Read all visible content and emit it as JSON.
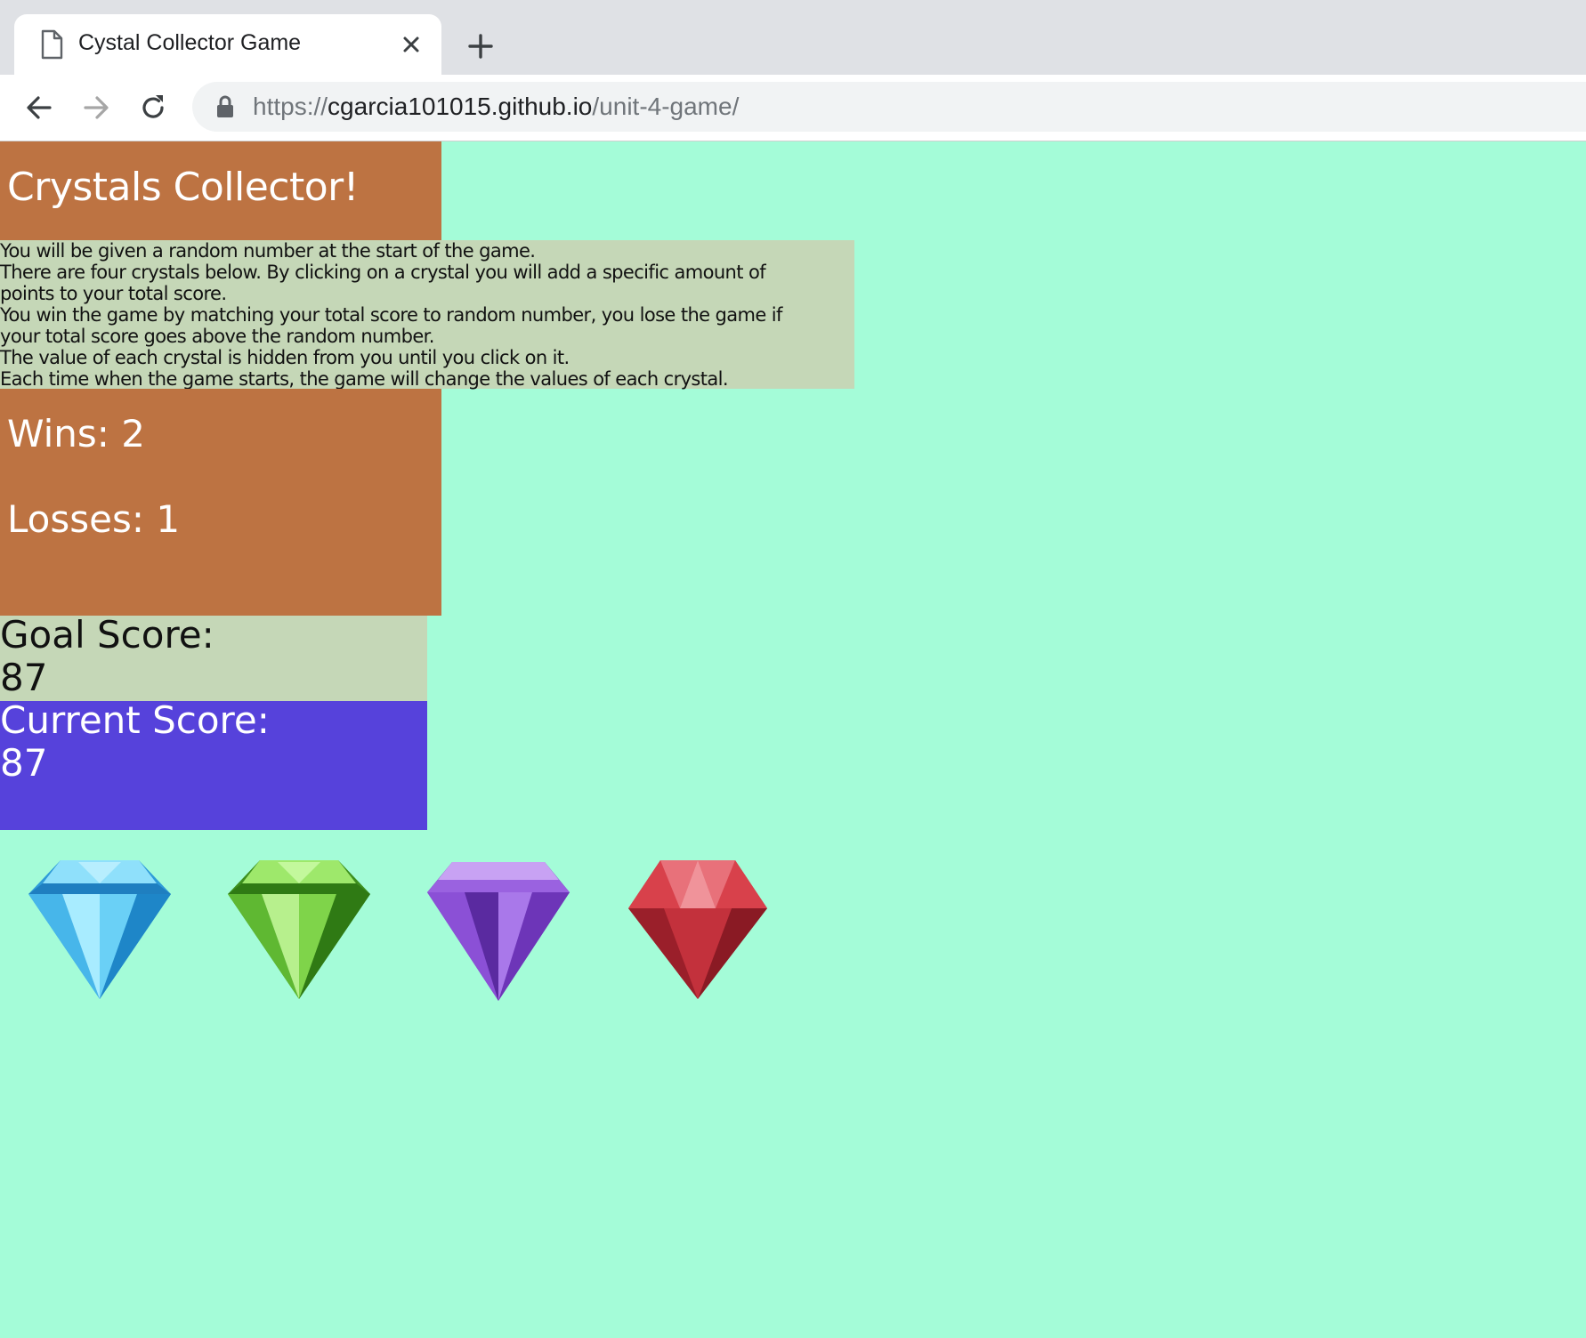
{
  "browser": {
    "tab_title": "Cystal Collector Game",
    "url_scheme": "https://",
    "url_host": "cgarcia101015.github.io",
    "url_path": "/unit-4-game/"
  },
  "game": {
    "title": "Crystals Collector!",
    "instructions": [
      "You will be given a random number at the start of the game.",
      "There are four crystals below. By clicking on a crystal you will add a specific amount of",
      "points to your total score.",
      "You win the game by matching your total score to random number, you lose the game if",
      "your total score goes above the random number.",
      "The value of each crystal is hidden from you until you click on it.",
      "Each time when the game starts, the game will change the values of each crystal."
    ],
    "wins_text": "Wins: 2",
    "losses_text": "Losses: 1",
    "goal_label": "Goal Score:",
    "goal_value": "87",
    "current_label": "Current Score:",
    "current_value": "87",
    "crystals": [
      {
        "name": "blue-crystal",
        "color": "#56c4f0"
      },
      {
        "name": "green-crystal",
        "color": "#6fcf3a"
      },
      {
        "name": "purple-crystal",
        "color": "#9b5ce0"
      },
      {
        "name": "red-crystal",
        "color": "#d8353f"
      }
    ]
  },
  "colors": {
    "page_background": "#a4fcd8",
    "header_background": "#bd7342",
    "panel_background": "#c5d7b7",
    "current_score_background": "#5642db"
  }
}
